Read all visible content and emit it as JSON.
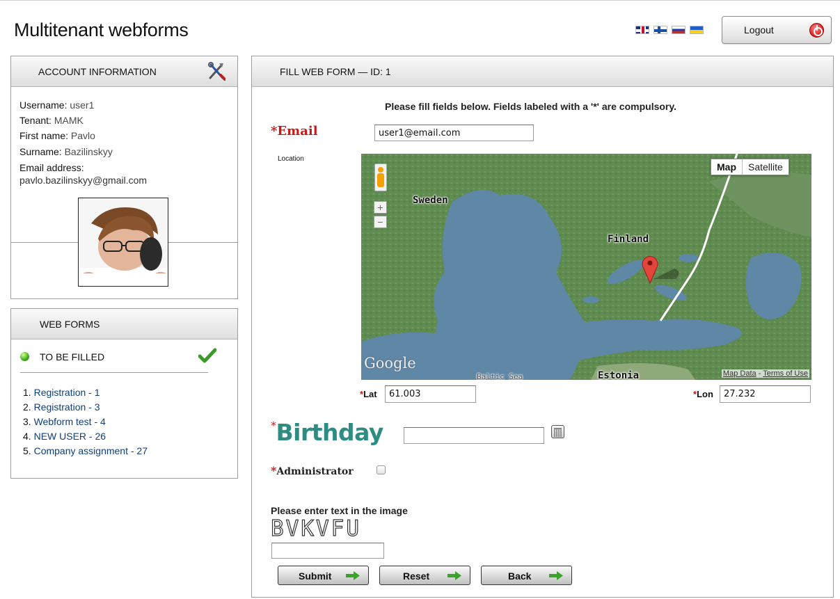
{
  "header": {
    "app_title": "Multitenant webforms",
    "languages": [
      "english-flag-icon",
      "finnish-flag-icon",
      "russian-flag-icon",
      "ukrainian-flag-icon"
    ],
    "logout_label": "Logout"
  },
  "account": {
    "title": "ACCOUNT INFORMATION",
    "username_label": "Username:",
    "username": "user1",
    "tenant_label": "Tenant:",
    "tenant": "MAMK",
    "first_name_label": "First name:",
    "first_name": "Pavlo",
    "surname_label": "Surname:",
    "surname": "Bazilinskyy",
    "email_label": "Email address:",
    "email": "pavlo.bazilinskyy@gmail.com"
  },
  "webforms": {
    "title": "WEB FORMS",
    "status": "TO BE FILLED",
    "items": [
      {
        "num": "1.",
        "label": "Registration - 1"
      },
      {
        "num": "2.",
        "label": "Registration - 3"
      },
      {
        "num": "3.",
        "label": "Webform test - 4"
      },
      {
        "num": "4.",
        "label": "NEW USER - 26"
      },
      {
        "num": "5.",
        "label": "Company assignment - 27"
      }
    ]
  },
  "form": {
    "title": "FILL WEB FORM — ID: 1",
    "instructions": "Please fill fields below. Fields labeled with a '*' are compulsory.",
    "required_mark": "*",
    "email_label": "Email",
    "email_value": "user1@email.com",
    "location_label": "Location",
    "lat_label": "Lat",
    "lat_value": "61.003",
    "lon_label": "Lon",
    "lon_value": "27.232",
    "birthday_label": "Birthday",
    "birthday_value": "",
    "admin_label": "Administrator",
    "admin_checked": false,
    "captcha_prompt": "Please enter text in the image",
    "captcha_text": "BVKVFU",
    "captcha_value": "",
    "buttons": {
      "submit": "Submit",
      "reset": "Reset",
      "back": "Back"
    }
  },
  "map": {
    "type_map": "Map",
    "type_satellite": "Satellite",
    "labels": {
      "sweden": "Sweden",
      "finland": "Finland",
      "estonia": "Estonia",
      "baltic": "Baltic Sea"
    },
    "zoom_in": "+",
    "zoom_out": "−",
    "google": "Google",
    "map_data": "Map Data",
    "separator": " - ",
    "terms": "Terms of Use"
  },
  "colors": {
    "required": "#c41a1a",
    "birthday": "#2d8d83",
    "link": "#0f3f7a",
    "status_green": "#3fae1a"
  }
}
